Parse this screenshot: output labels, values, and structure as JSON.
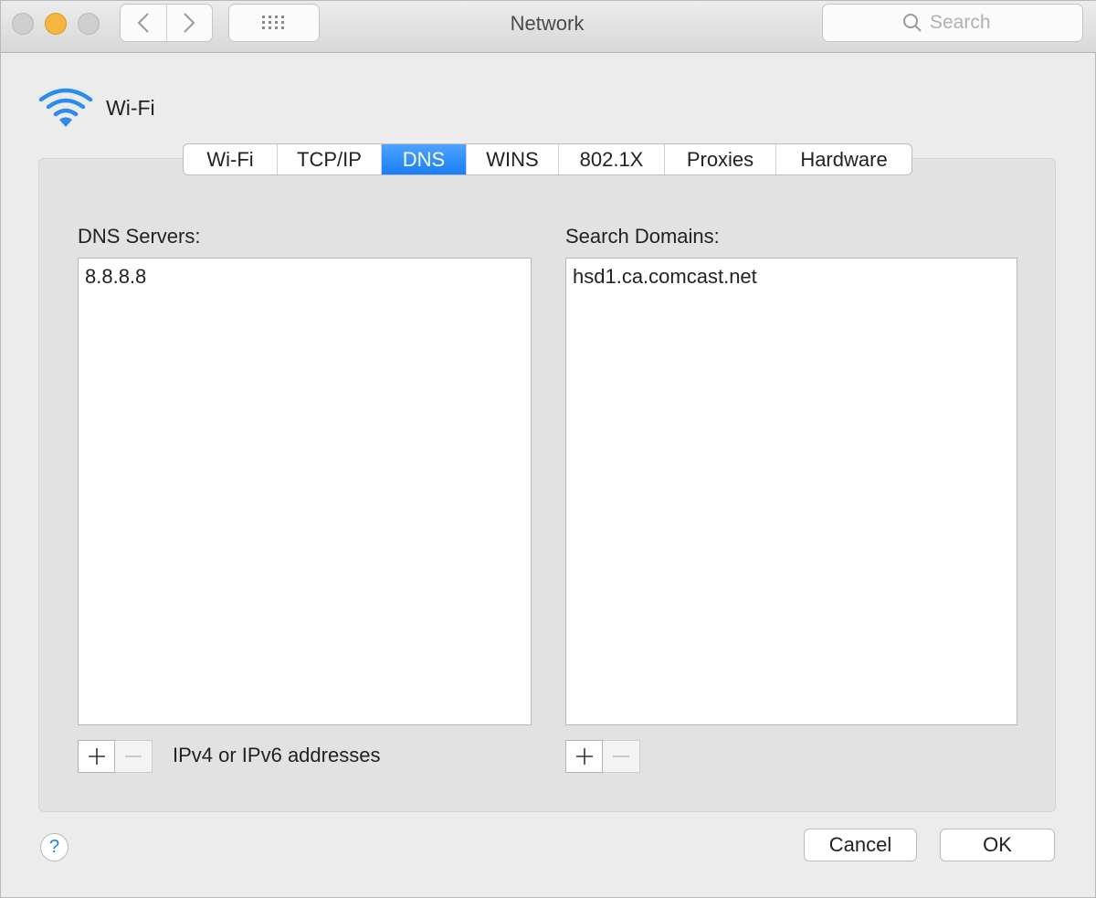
{
  "window": {
    "title": "Network",
    "search_placeholder": "Search"
  },
  "interface": {
    "name": "Wi-Fi",
    "icon": "wifi-icon"
  },
  "tabs": [
    {
      "label": "Wi-Fi",
      "active": false
    },
    {
      "label": "TCP/IP",
      "active": false
    },
    {
      "label": "DNS",
      "active": true
    },
    {
      "label": "WINS",
      "active": false
    },
    {
      "label": "802.1X",
      "active": false
    },
    {
      "label": "Proxies",
      "active": false
    },
    {
      "label": "Hardware",
      "active": false
    }
  ],
  "dns_servers": {
    "label": "DNS Servers:",
    "items": [
      "8.8.8.8"
    ],
    "hint": "IPv4 or IPv6 addresses"
  },
  "search_domains": {
    "label": "Search Domains:",
    "items": [
      "hsd1.ca.comcast.net"
    ]
  },
  "buttons": {
    "help": "?",
    "cancel": "Cancel",
    "ok": "OK"
  },
  "colors": {
    "accent": "#1a7ef5",
    "wifi_icon": "#2a8cf0",
    "minimize": "#f6b53e"
  }
}
